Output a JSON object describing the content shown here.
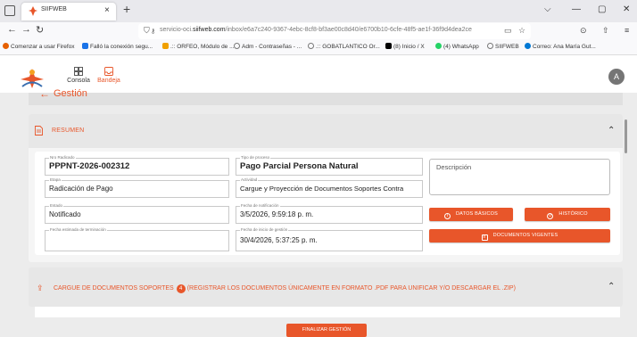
{
  "browser": {
    "tab_title": "SIIFWEB",
    "tab_close": "×",
    "new_tab": "+",
    "url_prefix": "servicio-oci.",
    "url_domain": "siifweb.com",
    "url_path": "/inbox/e6a7c240-9367-4ebc-8cf8-bf3ae00c8d40/e6700b10-6cfe-48f5-ae1f-36f9d4dea2ce",
    "bookmarks": [
      {
        "label": "Comenzar a usar Firefox",
        "color": "#e66000"
      },
      {
        "label": "Falló la conexión segu...",
        "color": "#1a73e8"
      },
      {
        "label": ".:: ORFEO, Módulo de ...",
        "color": "#f0a000"
      },
      {
        "label": "Adm - Contraseñas - ...",
        "color": "#777777"
      },
      {
        "label": ".:: GOBATLANTICO Or...",
        "color": "#777777"
      },
      {
        "label": "(8) Inicio / X",
        "color": "#000000"
      },
      {
        "label": "(4) WhatsApp",
        "color": "#25d366"
      },
      {
        "label": "SIIFWEB",
        "color": "#777777"
      },
      {
        "label": "Correo: Ana María Gut...",
        "color": "#0078d4"
      }
    ]
  },
  "header": {
    "nav": [
      {
        "label": "Consola",
        "icon": "console-icon"
      },
      {
        "label": "Bandeja",
        "icon": "inbox-icon"
      }
    ],
    "avatar": "A"
  },
  "page": {
    "title": "Gestión",
    "resumen": {
      "title": "RESUMEN",
      "fields": {
        "radicado": {
          "label": "Nro Radicado",
          "value": "PPPNT-2026-002312"
        },
        "tipo_proceso": {
          "label": "Tipo de proceso",
          "value": "Pago Parcial Persona Natural"
        },
        "etapa": {
          "label": "Etapa",
          "value": "Radicación de Pago"
        },
        "actividad": {
          "label": "Actividad",
          "value": "Cargue y Proyección de Documentos Soportes Contra"
        },
        "estado": {
          "label": "Estado",
          "value": "Notificado"
        },
        "fecha_notificacion": {
          "label": "Fecha de notificación",
          "value": "3/5/2026, 9:59:18 p. m."
        },
        "fecha_terminacion": {
          "label": "Fecha estimada de terminación",
          "value": ""
        },
        "fecha_inicio": {
          "label": "Fecha de inicio de gestión",
          "value": "30/4/2026, 5:37:25 p. m."
        }
      },
      "descripcion_label": "Descripción",
      "buttons": {
        "datos_basicos": "DATOS BÁSICOS",
        "historico": "HISTÓRICO",
        "documentos": "DOCUMENTOS VIGENTES"
      }
    },
    "cargue": {
      "title_pre": "CARGUE DE DOCUMENTOS SOPORTES",
      "badge": "4",
      "title_post": "(REGISTRAR LOS DOCUMENTOS ÚNICAMENTE EN FORMATO .PDF PARA UNIFICAR Y/O DESCARGAR EL .ZIP)"
    },
    "finalizar": "FINALIZAR GESTIÓN"
  },
  "colors": {
    "accent": "#e8562a"
  }
}
